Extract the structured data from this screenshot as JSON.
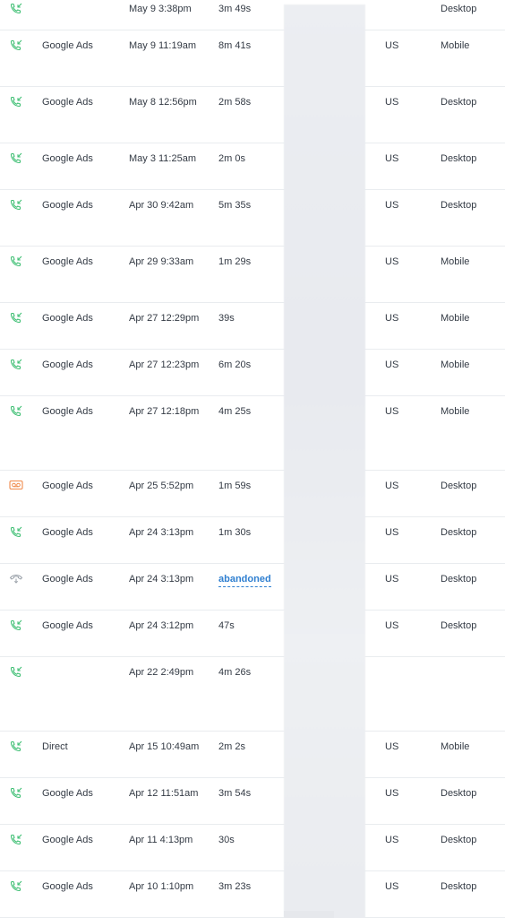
{
  "calls": [
    {
      "type": "answered",
      "source": "",
      "date": "May 9 3:38pm",
      "duration": "3m 49s",
      "country": "",
      "device": "Desktop"
    },
    {
      "type": "answered",
      "source": "Google Ads",
      "date": "May 9 11:19am",
      "duration": "8m 41s",
      "country": "US",
      "device": "Mobile"
    },
    {
      "type": "answered",
      "source": "Google Ads",
      "date": "May 8 12:56pm",
      "duration": "2m 58s",
      "country": "US",
      "device": "Desktop"
    },
    {
      "type": "answered",
      "source": "Google Ads",
      "date": "May 3 11:25am",
      "duration": "2m 0s",
      "country": "US",
      "device": "Desktop"
    },
    {
      "type": "answered",
      "source": "Google Ads",
      "date": "Apr 30 9:42am",
      "duration": "5m 35s",
      "country": "US",
      "device": "Desktop"
    },
    {
      "type": "answered",
      "source": "Google Ads",
      "date": "Apr 29 9:33am",
      "duration": "1m 29s",
      "country": "US",
      "device": "Mobile"
    },
    {
      "type": "answered",
      "source": "Google Ads",
      "date": "Apr 27 12:29pm",
      "duration": "39s",
      "country": "US",
      "device": "Mobile"
    },
    {
      "type": "answered",
      "source": "Google Ads",
      "date": "Apr 27 12:23pm",
      "duration": "6m 20s",
      "country": "US",
      "device": "Mobile"
    },
    {
      "type": "answered",
      "source": "Google Ads",
      "date": "Apr 27 12:18pm",
      "duration": "4m 25s",
      "country": "US",
      "device": "Mobile"
    },
    {
      "type": "voicemail",
      "source": "Google Ads",
      "date": "Apr 25 5:52pm",
      "duration": "1m 59s",
      "country": "US",
      "device": "Desktop"
    },
    {
      "type": "answered",
      "source": "Google Ads",
      "date": "Apr 24 3:13pm",
      "duration": "1m 30s",
      "country": "US",
      "device": "Desktop"
    },
    {
      "type": "abandoned",
      "source": "Google Ads",
      "date": "Apr 24 3:13pm",
      "duration": "abandoned",
      "country": "US",
      "device": "Desktop"
    },
    {
      "type": "answered",
      "source": "Google Ads",
      "date": "Apr 24 3:12pm",
      "duration": "47s",
      "country": "US",
      "device": "Desktop"
    },
    {
      "type": "answered",
      "source": "",
      "date": "Apr 22 2:49pm",
      "duration": "4m 26s",
      "country": "",
      "device": ""
    },
    {
      "type": "answered",
      "source": "Direct",
      "date": "Apr 15 10:49am",
      "duration": "2m 2s",
      "country": "US",
      "device": "Mobile"
    },
    {
      "type": "answered",
      "source": "Google Ads",
      "date": "Apr 12 11:51am",
      "duration": "3m 54s",
      "country": "US",
      "device": "Desktop"
    },
    {
      "type": "answered",
      "source": "Google Ads",
      "date": "Apr 11 4:13pm",
      "duration": "30s",
      "country": "US",
      "device": "Desktop"
    },
    {
      "type": "answered",
      "source": "Google Ads",
      "date": "Apr 10 1:10pm",
      "duration": "3m 23s",
      "country": "US",
      "device": "Desktop"
    }
  ],
  "icons": {
    "answered": "incoming-call-icon",
    "voicemail": "voicemail-icon",
    "abandoned": "abandoned-call-icon"
  },
  "colors": {
    "answered": "#3fbf74",
    "voicemail": "#f08a4b",
    "abandoned": "#9aa1a9",
    "link": "#2f7fd0",
    "divider": "#e9ecef",
    "redacted": "#e9ebef"
  }
}
